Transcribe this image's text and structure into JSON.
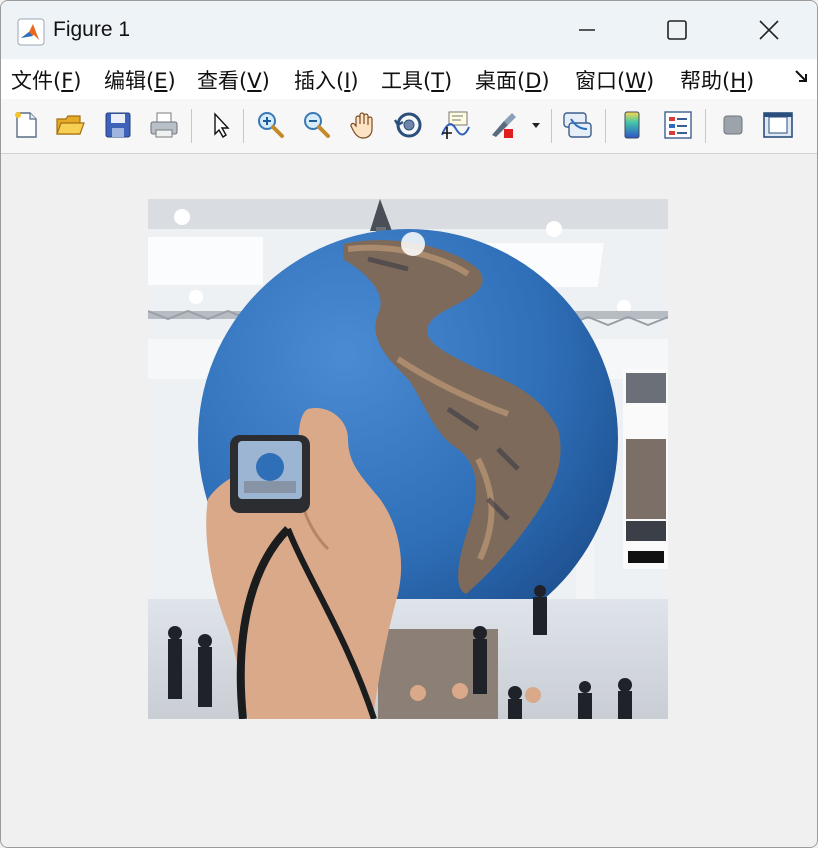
{
  "window": {
    "title": "Figure 1",
    "app_icon": "matlab-icon",
    "controls": [
      "minimize-icon",
      "maximize-icon",
      "close-icon"
    ]
  },
  "menu": {
    "items": [
      {
        "text": "文件(",
        "key": "F",
        "end": ")"
      },
      {
        "text": "编辑(",
        "key": "E",
        "end": ")"
      },
      {
        "text": "查看(",
        "key": "V",
        "end": ")"
      },
      {
        "text": "插入(",
        "key": "I",
        "end": ")"
      },
      {
        "text": "工具(",
        "key": "T",
        "end": ")"
      },
      {
        "text": "桌面(",
        "key": "D",
        "end": ")"
      },
      {
        "text": "窗口(",
        "key": "W",
        "end": ")"
      },
      {
        "text": "帮助(",
        "key": "H",
        "end": ")"
      }
    ],
    "more_icon": "toolbar-overflow-arrow-icon"
  },
  "toolbar": {
    "icons": [
      "new-figure-icon",
      "open-file-icon",
      "save-icon",
      "print-icon",
      "select-arrow-icon",
      "zoom-in-icon",
      "zoom-out-icon",
      "pan-hand-icon",
      "rotate-3d-icon",
      "data-cursor-icon",
      "brush-icon",
      "brush-dropdown-icon",
      "link-plot-icon",
      "colorbar-icon",
      "legend-icon",
      "hide-plot-tools-icon",
      "show-plot-tools-icon"
    ]
  },
  "figure": {
    "image_description_name": "globe-photo",
    "photo_colors": {
      "sky": "#eef1f4",
      "ocean": "#2f6fb8",
      "skin": "#d9a98a"
    }
  }
}
